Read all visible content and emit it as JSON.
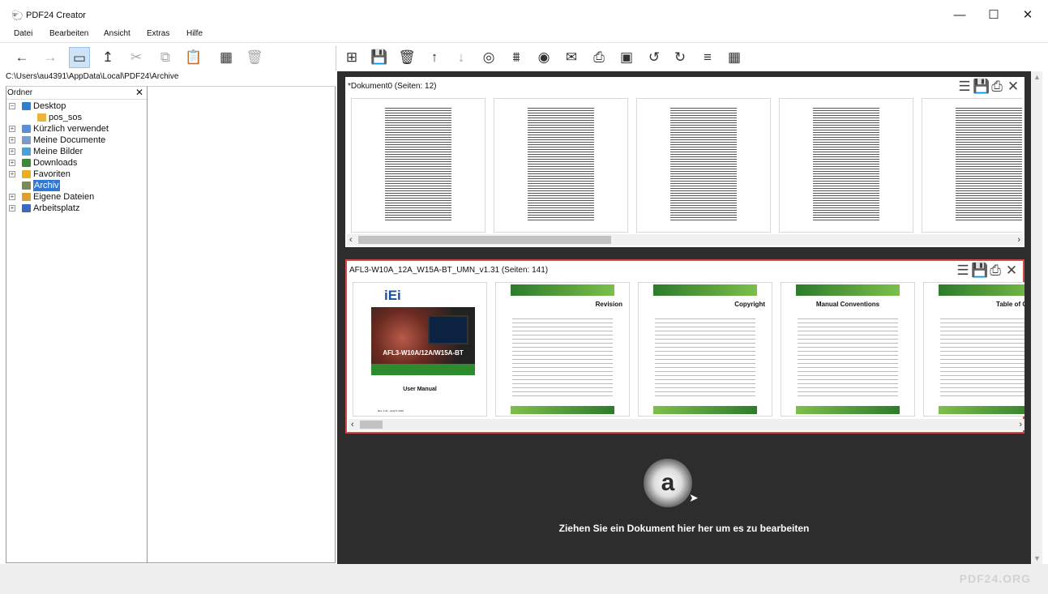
{
  "window": {
    "title": "PDF24 Creator",
    "logo": "sheep-icon",
    "minimize": "—",
    "maximize": "☐",
    "close": "✕"
  },
  "menu": [
    "Datei",
    "Bearbeiten",
    "Ansicht",
    "Extras",
    "Hilfe"
  ],
  "left_toolbar": [
    {
      "name": "back-icon",
      "glyph": "←"
    },
    {
      "name": "forward-icon",
      "glyph": "→"
    },
    {
      "name": "folder-view-icon",
      "glyph": "▭"
    },
    {
      "name": "up-folder-icon",
      "glyph": "↥"
    },
    {
      "name": "cut-icon",
      "glyph": "✂"
    },
    {
      "name": "copy-icon",
      "glyph": "⧉"
    },
    {
      "name": "paste-icon",
      "glyph": "📋"
    },
    {
      "name": "grid-view-icon",
      "glyph": "▦"
    },
    {
      "name": "delete-icon",
      "glyph": "🗑"
    }
  ],
  "doc_toolbar": [
    {
      "name": "new-document-icon",
      "glyph": "⊞"
    },
    {
      "name": "save-icon",
      "glyph": "💾"
    },
    {
      "name": "trash-icon",
      "glyph": "🗑"
    },
    {
      "name": "move-up-icon",
      "glyph": "↑"
    },
    {
      "name": "move-down-icon",
      "glyph": "↓"
    },
    {
      "name": "merge-icon",
      "glyph": "◎"
    },
    {
      "name": "split-icon",
      "glyph": "⩩"
    },
    {
      "name": "preview-icon",
      "glyph": "◉"
    },
    {
      "name": "email-icon",
      "glyph": "✉"
    },
    {
      "name": "print-icon",
      "glyph": "⎙"
    },
    {
      "name": "compress-icon",
      "glyph": "▣"
    },
    {
      "name": "rotate-left-icon",
      "glyph": "↺"
    },
    {
      "name": "rotate-right-icon",
      "glyph": "↻"
    },
    {
      "name": "sort-icon",
      "glyph": "≡"
    },
    {
      "name": "page-grid-icon",
      "glyph": "▦"
    }
  ],
  "path": "C:\\Users\\au4391\\AppData\\Local\\PDF24\\Archive",
  "folder_pane": {
    "title": "Ordner",
    "close": "✕"
  },
  "tree": [
    {
      "label": "Desktop",
      "icon": "desktop-icon",
      "expander": "−",
      "depth": 0,
      "color": "#2d7fd0",
      "selected": false
    },
    {
      "label": "pos_sos",
      "icon": "folder-icon",
      "expander": "",
      "depth": 1,
      "color": "#e9b43a",
      "selected": false
    },
    {
      "label": "Kürzlich verwendet",
      "icon": "recent-icon",
      "expander": "+",
      "depth": 0,
      "color": "#5a8fd8",
      "selected": false
    },
    {
      "label": "Meine Documente",
      "icon": "documents-icon",
      "expander": "+",
      "depth": 0,
      "color": "#7a9cc8",
      "selected": false
    },
    {
      "label": "Meine Bilder",
      "icon": "pictures-icon",
      "expander": "+",
      "depth": 0,
      "color": "#4aa0d8",
      "selected": false
    },
    {
      "label": "Downloads",
      "icon": "downloads-icon",
      "expander": "+",
      "depth": 0,
      "color": "#3a8a3a",
      "selected": false
    },
    {
      "label": "Favoriten",
      "icon": "star-icon",
      "expander": "+",
      "depth": 0,
      "color": "#e8b020",
      "selected": false
    },
    {
      "label": "Archiv",
      "icon": "archive-icon",
      "expander": "",
      "depth": 0,
      "color": "#7a8a5a",
      "selected": true
    },
    {
      "label": "Eigene Dateien",
      "icon": "user-files-icon",
      "expander": "+",
      "depth": 0,
      "color": "#e0a030",
      "selected": false
    },
    {
      "label": "Arbeitsplatz",
      "icon": "computer-icon",
      "expander": "+",
      "depth": 0,
      "color": "#3a6ac0",
      "selected": false
    }
  ],
  "documents": [
    {
      "title": "*Dokument0 (Seiten: 12)",
      "selected": false
    },
    {
      "title": "AFL3-W10A_12A_W15A-BT_UMN_v1.31 (Seiten: 141)",
      "selected": true
    }
  ],
  "doc_tools": [
    {
      "name": "menu-icon",
      "glyph": "☰"
    },
    {
      "name": "save-icon",
      "glyph": "💾"
    },
    {
      "name": "print-icon",
      "glyph": "⎙"
    },
    {
      "name": "close-icon",
      "glyph": "✕"
    }
  ],
  "doc2_pages": {
    "cover_logo": "iEi",
    "cover_model": "AFL3-W10A/12A/W15A-BT",
    "cover_title": "User Manual",
    "cover_rev": "Rev. 1.31 - April 8, 2019",
    "headings": [
      "Revision",
      "Copyright",
      "Manual Conventions",
      "Table of Contents"
    ]
  },
  "drop_zone": {
    "icon": "pdf24-logo-icon",
    "logo_letter": "a",
    "text": "Ziehen Sie ein Dokument hier her um es zu bearbeiten"
  },
  "brand": "PDF24.ORG"
}
